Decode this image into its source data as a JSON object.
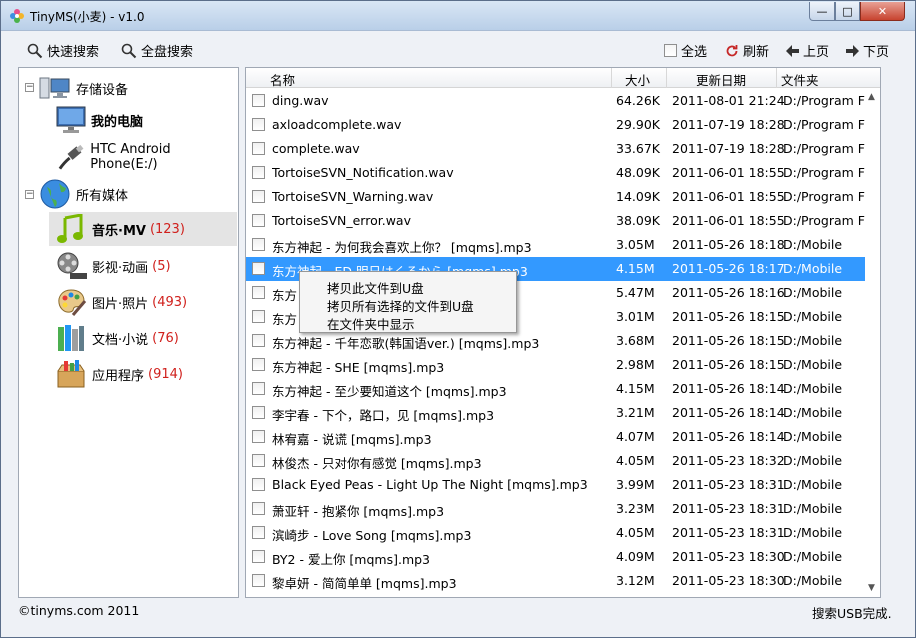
{
  "window": {
    "title": "TinyMS(小麦) - v1.0",
    "minimize": "—",
    "maximize": "□",
    "close": "✕"
  },
  "toolbar": {
    "quick_search": "快速搜索",
    "full_search": "全盘搜索",
    "select_all": "全选",
    "refresh": "刷新",
    "prev_page": "上页",
    "next_page": "下页"
  },
  "tree": {
    "storage": "存储设备",
    "my_computer": "我的电脑",
    "htc": "HTC Android Phone(E:/)",
    "all_media": "所有媒体",
    "music": {
      "label": "音乐·MV",
      "count": "(123)"
    },
    "video": {
      "label": "影视·动画",
      "count": "(5)"
    },
    "pictures": {
      "label": "图片·照片",
      "count": "(493)"
    },
    "documents": {
      "label": "文档·小说",
      "count": "(76)"
    },
    "apps": {
      "label": "应用程序",
      "count": "(914)"
    }
  },
  "table": {
    "headers": {
      "name": "名称",
      "size": "大小",
      "date": "更新日期",
      "folder": "文件夹"
    },
    "rows": [
      {
        "name": "ding.wav",
        "size": "64.26K",
        "date": "2011-08-01 21:24",
        "folder": "D:/Program Files"
      },
      {
        "name": "axloadcomplete.wav",
        "size": "29.90K",
        "date": "2011-07-19 18:28",
        "folder": "D:/Program Files"
      },
      {
        "name": "complete.wav",
        "size": "33.67K",
        "date": "2011-07-19 18:28",
        "folder": "D:/Program Files"
      },
      {
        "name": "TortoiseSVN_Notification.wav",
        "size": "48.09K",
        "date": "2011-06-01 18:55",
        "folder": "D:/Program Files"
      },
      {
        "name": "TortoiseSVN_Warning.wav",
        "size": "14.09K",
        "date": "2011-06-01 18:55",
        "folder": "D:/Program Files"
      },
      {
        "name": "TortoiseSVN_error.wav",
        "size": "38.09K",
        "date": "2011-06-01 18:55",
        "folder": "D:/Program Files"
      },
      {
        "name": "东方神起 - 为何我会喜欢上你？ [mqms].mp3",
        "size": "3.05M",
        "date": "2011-05-26 18:18",
        "folder": "D:/Mobile"
      },
      {
        "name": "东方神起 - ED 明日はくるから [mqms].mp3",
        "size": "4.15M",
        "date": "2011-05-26 18:17",
        "folder": "D:/Mobile"
      },
      {
        "name": "东方",
        "size": "5.47M",
        "date": "2011-05-26 18:16",
        "folder": "D:/Mobile"
      },
      {
        "name": "东方",
        "size": "3.01M",
        "date": "2011-05-26 18:15",
        "folder": "D:/Mobile"
      },
      {
        "name": "东方神起 - 千年恋歌(韩国语ver.) [mqms].mp3",
        "size": "3.68M",
        "date": "2011-05-26 18:15",
        "folder": "D:/Mobile"
      },
      {
        "name": "东方神起 - SHE [mqms].mp3",
        "size": "2.98M",
        "date": "2011-05-26 18:15",
        "folder": "D:/Mobile"
      },
      {
        "name": "东方神起 - 至少要知道这个 [mqms].mp3",
        "size": "4.15M",
        "date": "2011-05-26 18:14",
        "folder": "D:/Mobile"
      },
      {
        "name": "李宇春 - 下个，路口，见 [mqms].mp3",
        "size": "3.21M",
        "date": "2011-05-26 18:14",
        "folder": "D:/Mobile"
      },
      {
        "name": "林宥嘉 - 说谎 [mqms].mp3",
        "size": "4.07M",
        "date": "2011-05-26 18:14",
        "folder": "D:/Mobile"
      },
      {
        "name": "林俊杰 - 只对你有感觉 [mqms].mp3",
        "size": "4.05M",
        "date": "2011-05-23 18:32",
        "folder": "D:/Mobile"
      },
      {
        "name": "Black Eyed Peas - Light Up The Night [mqms].mp3",
        "size": "3.99M",
        "date": "2011-05-23 18:31",
        "folder": "D:/Mobile"
      },
      {
        "name": "萧亚轩 - 抱紧你 [mqms].mp3",
        "size": "3.23M",
        "date": "2011-05-23 18:31",
        "folder": "D:/Mobile"
      },
      {
        "name": "滨崎步 - Love Song [mqms].mp3",
        "size": "4.05M",
        "date": "2011-05-23 18:31",
        "folder": "D:/Mobile"
      },
      {
        "name": "BY2 - 爱上你 [mqms].mp3",
        "size": "4.09M",
        "date": "2011-05-23 18:30",
        "folder": "D:/Mobile"
      },
      {
        "name": "黎卓妍 - 简简单单 [mqms].mp3",
        "size": "3.12M",
        "date": "2011-05-23 18:30",
        "folder": "D:/Mobile"
      }
    ]
  },
  "context_menu": {
    "copy_file": "拷贝此文件到U盘",
    "copy_selected": "拷贝所有选择的文件到U盘",
    "show_in_folder": "在文件夹中显示"
  },
  "statusbar": {
    "copyright": "©tinyms.com 2011",
    "status": "搜索USB完成."
  }
}
